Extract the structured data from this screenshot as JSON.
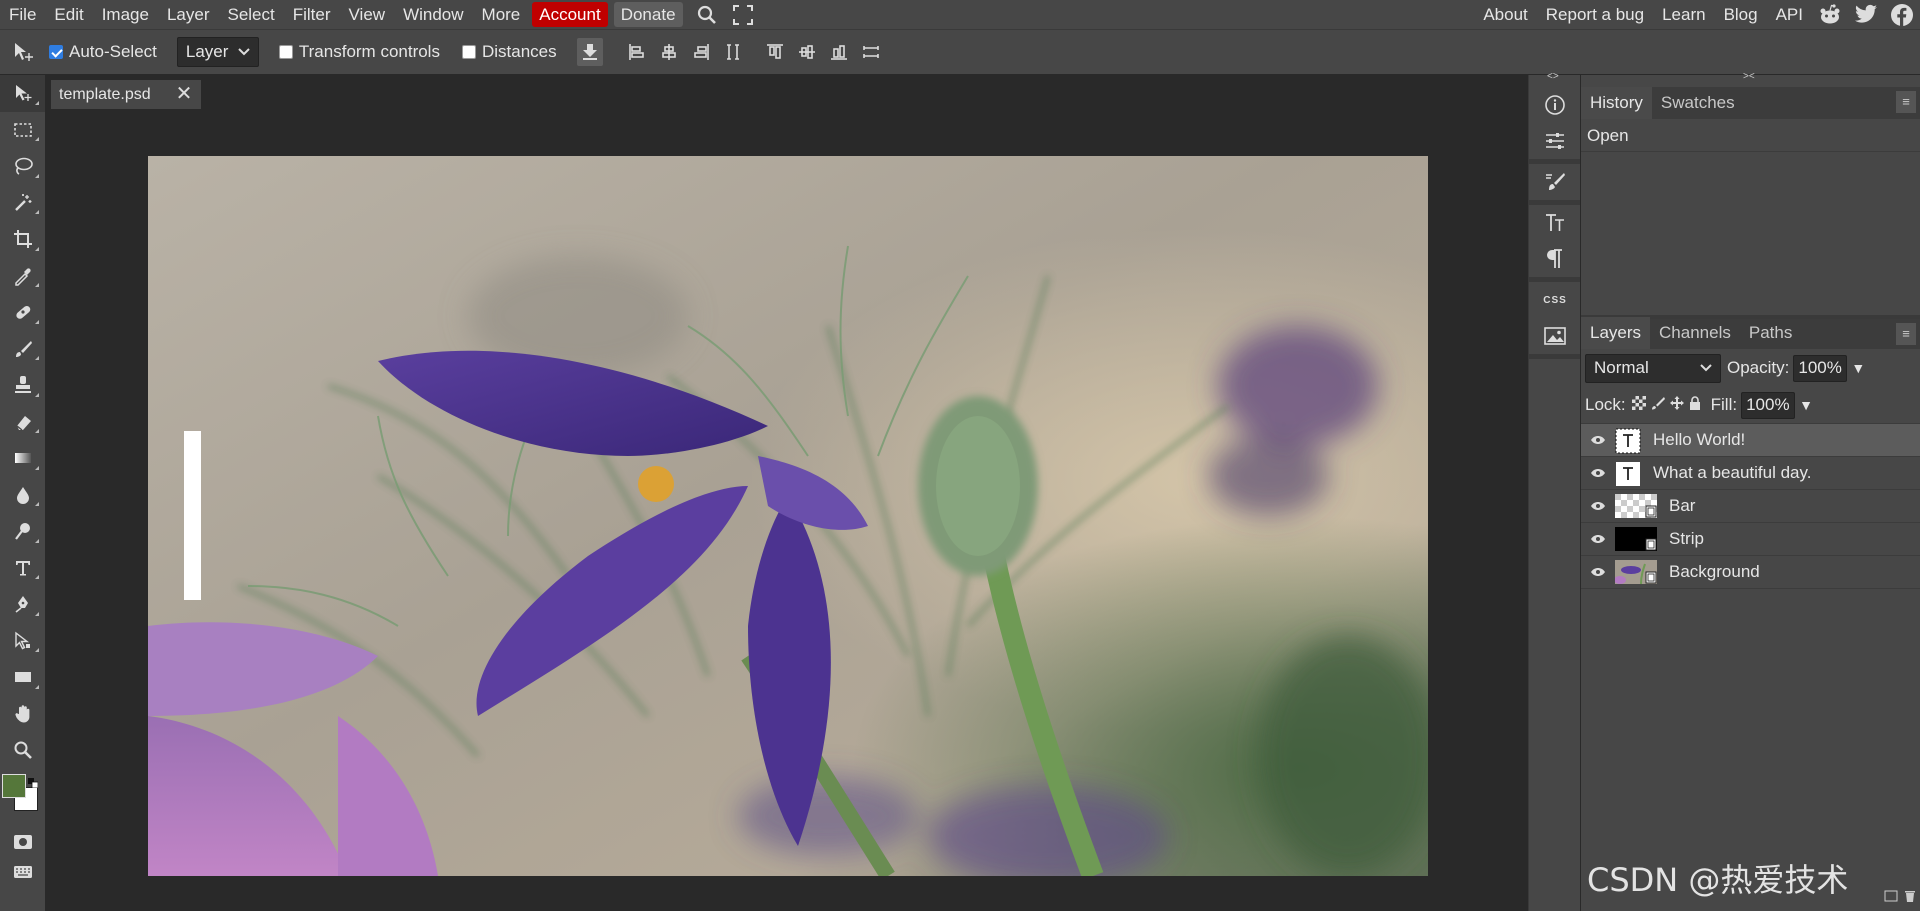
{
  "menu": {
    "items": [
      "File",
      "Edit",
      "Image",
      "Layer",
      "Select",
      "Filter",
      "View",
      "Window",
      "More"
    ],
    "account": "Account",
    "donate": "Donate",
    "right_links": [
      "About",
      "Report a bug",
      "Learn",
      "Blog",
      "API"
    ]
  },
  "options": {
    "auto_select_label": "Auto-Select",
    "auto_select_checked": true,
    "select_mode": "Layer",
    "transform_label": "Transform controls",
    "transform_checked": false,
    "distances_label": "Distances",
    "distances_checked": false
  },
  "document": {
    "tab_name": "template.psd",
    "close_glyph": "✕"
  },
  "strip": {
    "collapse_left": "<>",
    "collapse_right": "><",
    "css_label": "CSS"
  },
  "history": {
    "tabs": [
      "History",
      "Swatches"
    ],
    "entries": [
      "Open"
    ]
  },
  "layers": {
    "tabs": [
      "Layers",
      "Channels",
      "Paths"
    ],
    "blend_mode": "Normal",
    "opacity_label": "Opacity:",
    "opacity_value": "100%",
    "lock_label": "Lock:",
    "fill_label": "Fill:",
    "fill_value": "100%",
    "list": [
      {
        "name": "Hello World!",
        "kind": "text",
        "selected": true
      },
      {
        "name": "What a beautiful day.",
        "kind": "text",
        "selected": false
      },
      {
        "name": "Bar",
        "kind": "smart-transparent",
        "selected": false
      },
      {
        "name": "Strip",
        "kind": "smart-black",
        "selected": false
      },
      {
        "name": "Background",
        "kind": "smart-image",
        "selected": false
      }
    ]
  },
  "watermark": "CSDN @热爱技术",
  "colors": {
    "account_bg": "#c00000",
    "foreground": "#55773a",
    "background": "#ffffff"
  }
}
